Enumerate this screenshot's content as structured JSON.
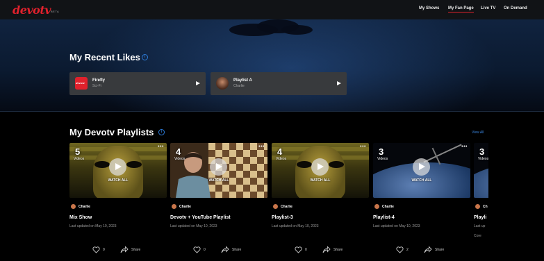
{
  "header": {
    "logo": "devotv",
    "beta": "BETA",
    "nav": [
      "My Shows",
      "My Fan Page",
      "Live TV",
      "On Demand"
    ],
    "active_nav": "My Fan Page"
  },
  "colors": {
    "brand_red": "#e0212c",
    "link_blue": "#3b86e0",
    "card_bg": "#383a3d"
  },
  "recent_likes": {
    "title": "My Recent Likes",
    "items": [
      {
        "name": "Firefly",
        "sub": "Sci-Fi",
        "thumb_text": "devotv",
        "thumb_icon": "devotv-logo-icon"
      },
      {
        "name": "Playlist A",
        "sub": "Charlie",
        "thumb_icon": "avatar-icon"
      }
    ]
  },
  "playlists": {
    "title": "My Devotv Playlists",
    "view_all": "View All",
    "watch_all": "WATCH ALL",
    "videos_label": "Videos",
    "items": [
      {
        "count": "5",
        "owner": "Charlie",
        "title": "Mix Show",
        "updated": "Last updated on May 10, 2023",
        "likes": "0",
        "share": "Share",
        "art": "pharaoh"
      },
      {
        "count": "4",
        "owner": "Charlie",
        "title": "Devotv + YouTube Playlist",
        "updated": "Last updated on May 10, 2023",
        "likes": "0",
        "share": "Share",
        "art": "chess"
      },
      {
        "count": "4",
        "owner": "Charlie",
        "title": "Playlist-3",
        "updated": "Last updated on May 10, 2023",
        "likes": "0",
        "share": "Share",
        "art": "pharaoh"
      },
      {
        "count": "3",
        "owner": "Charlie",
        "title": "Playlist-4",
        "updated": "Last updated on May 10, 2023",
        "likes": "2",
        "share": "Share",
        "art": "space"
      },
      {
        "count": "3",
        "owner": "Ch",
        "title": "Playli",
        "updated": "Last up",
        "extra": "Core",
        "art": "space"
      }
    ]
  }
}
